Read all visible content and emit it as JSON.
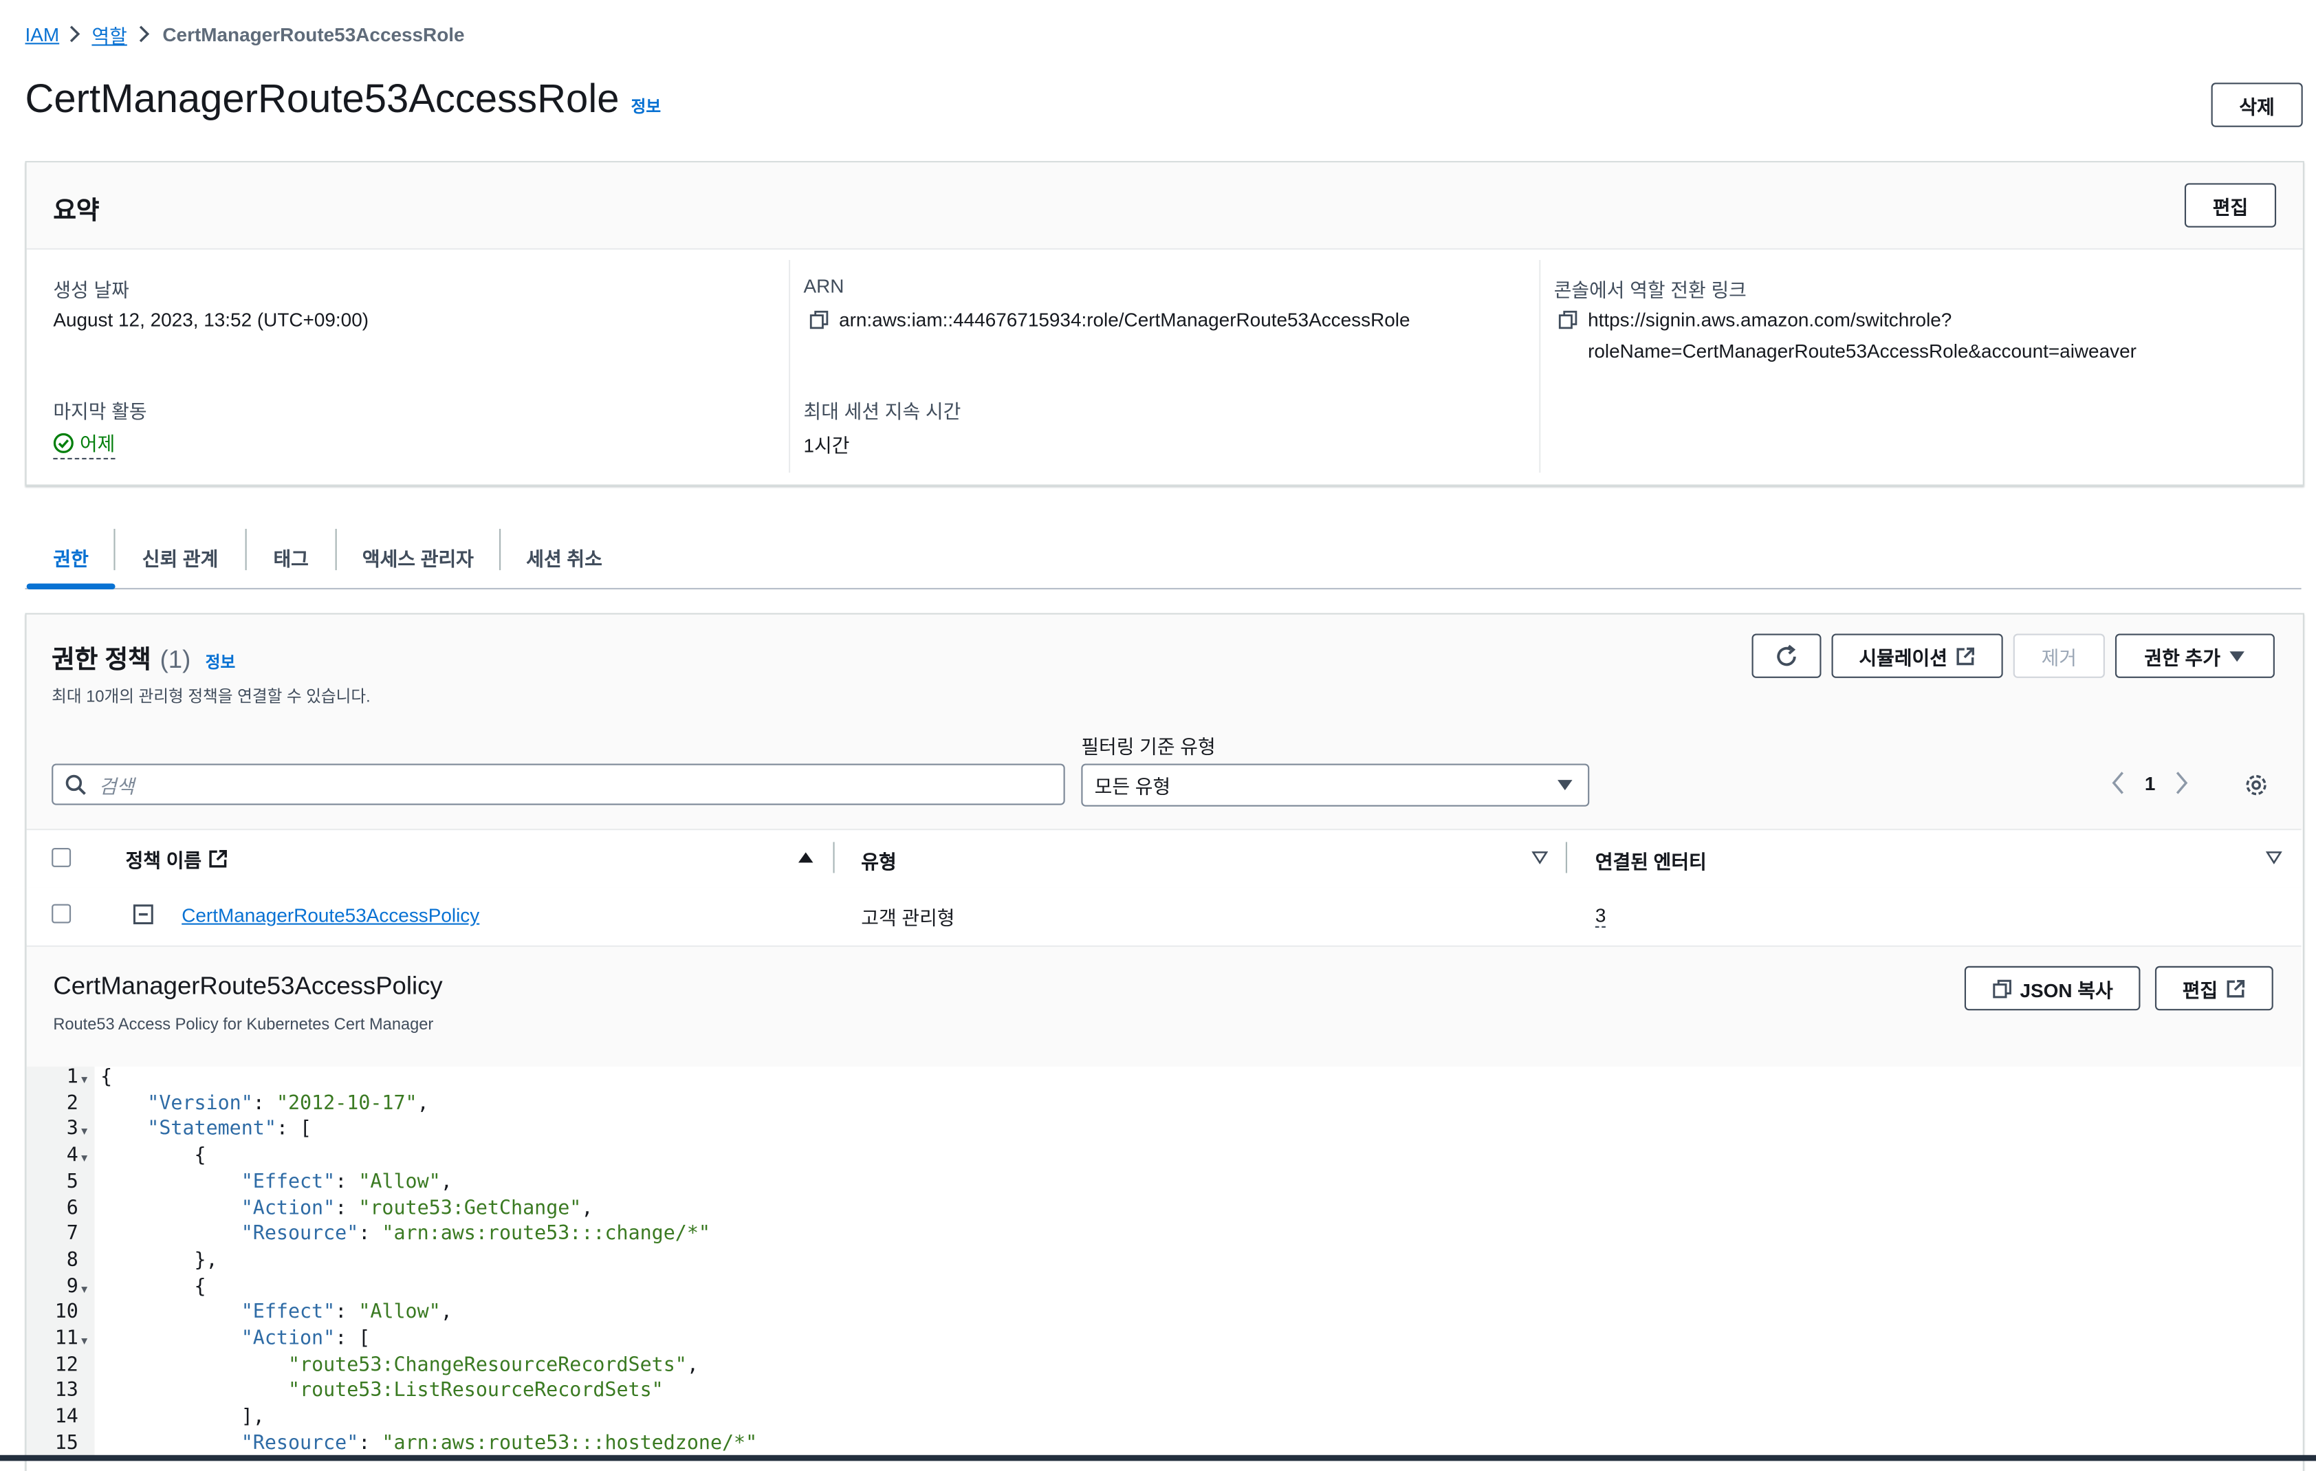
{
  "breadcrumb": {
    "root": "IAM",
    "roles": "역할",
    "current": "CertManagerRoute53AccessRole"
  },
  "header": {
    "title": "CertManagerRoute53AccessRole",
    "info": "정보",
    "delete_label": "삭제"
  },
  "summary": {
    "title": "요약",
    "edit_label": "편집",
    "created_label": "생성 날짜",
    "created_value": "August 12, 2023, 13:52 (UTC+09:00)",
    "arn_label": "ARN",
    "arn_value": "arn:aws:iam::444676715934:role/CertManagerRoute53AccessRole",
    "switch_label": "콘솔에서 역할 전환 링크",
    "switch_line1": "https://signin.aws.amazon.com/switchrole?",
    "switch_line2": "roleName=CertManagerRoute53AccessRole&account=aiweaver",
    "last_activity_label": "마지막 활동",
    "last_activity_value": "어제",
    "session_label": "최대 세션 지속 시간",
    "session_value": "1시간"
  },
  "tabs": [
    "권한",
    "신뢰 관계",
    "태그",
    "액세스 관리자",
    "세션 취소"
  ],
  "policies": {
    "title": "권한 정책",
    "count": "(1)",
    "info": "정보",
    "description": "최대 10개의 관리형 정책을 연결할 수 있습니다.",
    "simulate_label": "시뮬레이션",
    "remove_label": "제거",
    "add_label": "권한 추가",
    "filter_label": "필터링 기준 유형",
    "search_placeholder": "검색",
    "filter_value": "모든 유형",
    "page": "1",
    "columns": {
      "name": "정책 이름",
      "type": "유형",
      "entities": "연결된 엔터티"
    },
    "row": {
      "name": "CertManagerRoute53AccessPolicy",
      "type": "고객 관리형",
      "entities": "3"
    }
  },
  "detail": {
    "title": "CertManagerRoute53AccessPolicy",
    "description": "Route53 Access Policy for Kubernetes Cert Manager",
    "copy_json_label": "JSON 복사",
    "edit_label": "편집"
  },
  "code_lines": [
    "{",
    "    \"Version\": \"2012-10-17\",",
    "    \"Statement\": [",
    "        {",
    "            \"Effect\": \"Allow\",",
    "            \"Action\": \"route53:GetChange\",",
    "            \"Resource\": \"arn:aws:route53:::change/*\"",
    "        },",
    "        {",
    "            \"Effect\": \"Allow\",",
    "            \"Action\": [",
    "                \"route53:ChangeResourceRecordSets\",",
    "                \"route53:ListResourceRecordSets\"",
    "            ],",
    "            \"Resource\": \"arn:aws:route53:::hostedzone/*\""
  ],
  "colors": {
    "link": "#0972d3",
    "success": "#037f0c",
    "border": "#414d5c",
    "json_key": "#2e6ba5",
    "json_string": "#3a7a22"
  }
}
